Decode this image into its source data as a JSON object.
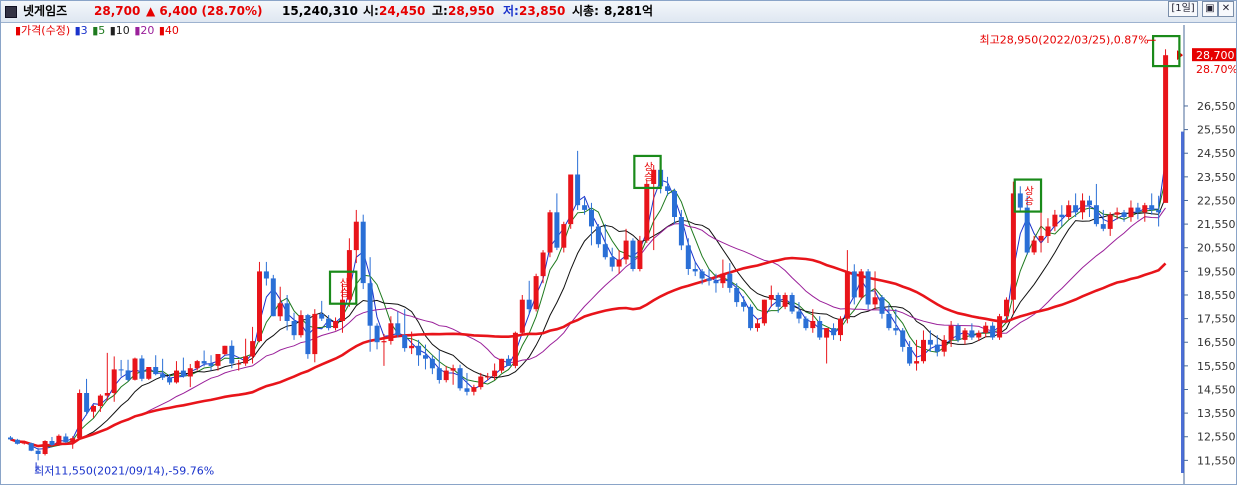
{
  "header": {
    "name": "넷게임즈",
    "price": "28,700",
    "change": "▲ 6,400 (28.70%)",
    "volume": "15,240,310",
    "open_label": "시:",
    "open": "24,450",
    "high_label": "고:",
    "high": "28,950",
    "low_label": "저:",
    "low": "23,850",
    "mktcap_label": "시총:",
    "mktcap": "8,281억",
    "period_button": "[1일]",
    "btn_restore": "▣",
    "btn_close": "✕",
    "btn_menu": "▪"
  },
  "legend": [
    {
      "text": "▮가격(수정)",
      "color": "#e60000"
    },
    {
      "text": "▮3",
      "color": "#1a33cc"
    },
    {
      "text": "▮5",
      "color": "#1e7a1e"
    },
    {
      "text": "▮10",
      "color": "#222222"
    },
    {
      "text": "▮20",
      "color": "#9a209a"
    },
    {
      "text": "▮40",
      "color": "#e60000"
    }
  ],
  "colors": {
    "up": "#e8141a",
    "down": "#2a6fd6",
    "ma3": "#1a33cc",
    "ma5": "#1e7a1e",
    "ma10": "#111111",
    "ma20": "#9a209a",
    "ma40": "#e8141a",
    "highlight": "#1a8a1a"
  },
  "annotations": {
    "high": "최고28,950(2022/03/25),0.87%",
    "low": "최저11,550(2021/09/14),-59.76%",
    "signal": "상승"
  },
  "chart_data": {
    "type": "candlestick",
    "ylim": [
      11100,
      29300
    ],
    "y_ticks": [
      11550,
      12550,
      13550,
      14550,
      15550,
      16550,
      17550,
      18550,
      19550,
      20550,
      21550,
      22550,
      23550,
      24550,
      25550,
      26550
    ],
    "current_price_label": "28,700",
    "current_change_label": "28.70%",
    "series": [
      {
        "name": "가격(수정)",
        "ohlc": [
          [
            12520,
            12580,
            12410,
            12440
          ],
          [
            12420,
            12460,
            12220,
            12250
          ],
          [
            12300,
            12380,
            12220,
            12300
          ],
          [
            12280,
            12300,
            11940,
            11960
          ],
          [
            11960,
            12070,
            11550,
            11820
          ],
          [
            11820,
            12400,
            11760,
            12370
          ],
          [
            12370,
            12540,
            12160,
            12200
          ],
          [
            12200,
            12650,
            12160,
            12590
          ],
          [
            12560,
            12690,
            12290,
            12320
          ],
          [
            12320,
            12570,
            12040,
            12490
          ],
          [
            12490,
            14550,
            12430,
            14400
          ],
          [
            14400,
            15000,
            13450,
            13600
          ],
          [
            13610,
            13900,
            13350,
            13850
          ],
          [
            13850,
            14350,
            13600,
            14290
          ],
          [
            14290,
            16100,
            14070,
            14400
          ],
          [
            14400,
            15950,
            14030,
            15400
          ],
          [
            15400,
            15800,
            15100,
            15360
          ],
          [
            15360,
            15810,
            14900,
            14960
          ],
          [
            14960,
            15900,
            14930,
            15860
          ],
          [
            15860,
            16000,
            14900,
            15000
          ],
          [
            15000,
            15500,
            14950,
            15500
          ],
          [
            15500,
            16000,
            15150,
            15200
          ],
          [
            15200,
            15850,
            14950,
            15050
          ],
          [
            15050,
            15200,
            14750,
            14850
          ],
          [
            14850,
            15750,
            14800,
            15350
          ],
          [
            15350,
            15900,
            15050,
            15100
          ],
          [
            15100,
            15630,
            14650,
            15450
          ],
          [
            15450,
            15800,
            15350,
            15750
          ],
          [
            15750,
            16200,
            15530,
            15650
          ],
          [
            15650,
            16000,
            15350,
            15550
          ],
          [
            15550,
            16050,
            15350,
            16050
          ],
          [
            16050,
            16400,
            16000,
            16400
          ],
          [
            16400,
            16630,
            15450,
            15650
          ],
          [
            15650,
            15800,
            15350,
            15650
          ],
          [
            15650,
            16700,
            15550,
            15950
          ],
          [
            15950,
            17200,
            15650,
            16600
          ],
          [
            16600,
            19950,
            16550,
            19550
          ],
          [
            19550,
            19950,
            18950,
            19250
          ],
          [
            19250,
            19400,
            17650,
            17650
          ],
          [
            17650,
            18900,
            17450,
            18200
          ],
          [
            18200,
            18550,
            17050,
            17450
          ],
          [
            17450,
            17800,
            16650,
            16850
          ],
          [
            16850,
            17900,
            16750,
            17700
          ],
          [
            17700,
            17750,
            15850,
            16050
          ],
          [
            16050,
            17950,
            15700,
            17750
          ],
          [
            17750,
            18300,
            17450,
            17550
          ],
          [
            17550,
            17700,
            17050,
            17150
          ],
          [
            17150,
            17600,
            17050,
            17450
          ],
          [
            17450,
            19050,
            16950,
            18350
          ],
          [
            18350,
            20950,
            18050,
            20450
          ],
          [
            20450,
            22150,
            19900,
            21650
          ],
          [
            21650,
            21950,
            18800,
            19050
          ],
          [
            19050,
            20150,
            16150,
            17250
          ],
          [
            17250,
            17350,
            16250,
            16550
          ],
          [
            16550,
            16900,
            15550,
            16600
          ],
          [
            16600,
            17650,
            16450,
            17350
          ],
          [
            17350,
            17850,
            16750,
            16850
          ],
          [
            16850,
            17950,
            16150,
            16300
          ],
          [
            16300,
            17000,
            16050,
            16400
          ],
          [
            16400,
            16650,
            15550,
            16000
          ],
          [
            16000,
            16450,
            15400,
            15850
          ],
          [
            15850,
            16000,
            15200,
            15450
          ],
          [
            15450,
            16200,
            14800,
            14950
          ],
          [
            14950,
            15550,
            14850,
            15350
          ],
          [
            15350,
            15600,
            14750,
            15450
          ],
          [
            15450,
            15600,
            14500,
            14600
          ],
          [
            14600,
            15250,
            14300,
            14450
          ],
          [
            14450,
            14750,
            14300,
            14650
          ],
          [
            14650,
            15250,
            14550,
            15100
          ],
          [
            15100,
            15250,
            14950,
            15100
          ],
          [
            15100,
            15650,
            14950,
            15350
          ],
          [
            15350,
            15850,
            15250,
            15850
          ],
          [
            15850,
            16000,
            15550,
            15550
          ],
          [
            15550,
            17000,
            15450,
            16950
          ],
          [
            16950,
            18550,
            16850,
            18350
          ],
          [
            18350,
            19150,
            17750,
            17950
          ],
          [
            17950,
            19450,
            17850,
            19350
          ],
          [
            19350,
            20450,
            19050,
            20350
          ],
          [
            20350,
            22150,
            20150,
            22050
          ],
          [
            22050,
            22850,
            20450,
            20550
          ],
          [
            20550,
            21650,
            20350,
            21550
          ],
          [
            21550,
            23650,
            21350,
            23650
          ],
          [
            23650,
            24650,
            22150,
            22350
          ],
          [
            22350,
            22650,
            21950,
            22150
          ],
          [
            22150,
            22450,
            20650,
            21450
          ],
          [
            21450,
            21550,
            20550,
            20700
          ],
          [
            20700,
            21550,
            20050,
            20150
          ],
          [
            20150,
            20550,
            19550,
            19750
          ],
          [
            19750,
            20450,
            19450,
            20050
          ],
          [
            20050,
            21350,
            19850,
            20850
          ],
          [
            20850,
            20950,
            19550,
            19650
          ],
          [
            19650,
            21050,
            19550,
            20850
          ],
          [
            20850,
            23400,
            20750,
            23250
          ],
          [
            23250,
            24050,
            20450,
            23850
          ],
          [
            23850,
            24050,
            22850,
            23150
          ],
          [
            23150,
            23550,
            22750,
            22950
          ],
          [
            22950,
            23050,
            21550,
            21850
          ],
          [
            21850,
            22150,
            20450,
            20650
          ],
          [
            20650,
            20950,
            19400,
            19650
          ],
          [
            19650,
            19950,
            19350,
            19550
          ],
          [
            19550,
            19650,
            19000,
            19250
          ],
          [
            19250,
            19650,
            18950,
            19150
          ],
          [
            19150,
            19450,
            18650,
            19050
          ],
          [
            19050,
            20050,
            18850,
            19450
          ],
          [
            19450,
            19900,
            18650,
            18850
          ],
          [
            18850,
            19050,
            18050,
            18250
          ],
          [
            18250,
            18500,
            17850,
            18050
          ],
          [
            18050,
            18150,
            17050,
            17150
          ],
          [
            17150,
            17550,
            17000,
            17350
          ],
          [
            17350,
            18350,
            17250,
            18350
          ],
          [
            18350,
            18950,
            18050,
            18550
          ],
          [
            18550,
            18650,
            17800,
            18050
          ],
          [
            18050,
            18650,
            17950,
            18550
          ],
          [
            18550,
            18650,
            17750,
            17850
          ],
          [
            17850,
            18250,
            17350,
            17550
          ],
          [
            17550,
            17650,
            17050,
            17150
          ],
          [
            17150,
            17950,
            16950,
            17450
          ],
          [
            17450,
            17650,
            16650,
            16750
          ],
          [
            16750,
            17150,
            15650,
            17150
          ],
          [
            17150,
            17350,
            16650,
            16850
          ],
          [
            16850,
            17650,
            16600,
            17550
          ],
          [
            17550,
            20450,
            17350,
            19550
          ],
          [
            19550,
            19850,
            18150,
            18450
          ],
          [
            18450,
            19650,
            18350,
            19550
          ],
          [
            19550,
            19650,
            17950,
            18150
          ],
          [
            18150,
            19550,
            17950,
            18450
          ],
          [
            18450,
            18550,
            17550,
            17750
          ],
          [
            17750,
            18150,
            17050,
            17150
          ],
          [
            17150,
            17950,
            16850,
            17050
          ],
          [
            17050,
            17150,
            16150,
            16350
          ],
          [
            16350,
            16600,
            15550,
            15650
          ],
          [
            15650,
            16650,
            15350,
            15750
          ],
          [
            15750,
            17050,
            15650,
            16650
          ],
          [
            16650,
            17050,
            16150,
            16450
          ],
          [
            16450,
            16850,
            15950,
            16150
          ],
          [
            16150,
            16850,
            15950,
            16650
          ],
          [
            16650,
            17450,
            16350,
            17250
          ],
          [
            17250,
            17350,
            16550,
            16650
          ],
          [
            16650,
            17150,
            16450,
            17050
          ],
          [
            17050,
            17350,
            16650,
            16750
          ],
          [
            16750,
            17050,
            16600,
            16950
          ],
          [
            16950,
            17400,
            16750,
            17250
          ],
          [
            17250,
            17400,
            16650,
            16750
          ],
          [
            16750,
            17750,
            16650,
            17650
          ],
          [
            17650,
            18450,
            17450,
            18350
          ],
          [
            18350,
            23350,
            17750,
            22850
          ],
          [
            22850,
            23150,
            22050,
            22250
          ],
          [
            22250,
            22750,
            20250,
            20350
          ],
          [
            20350,
            21050,
            20250,
            20850
          ],
          [
            20850,
            22850,
            20350,
            21050
          ],
          [
            21050,
            21800,
            20750,
            21450
          ],
          [
            21450,
            22150,
            21250,
            21950
          ],
          [
            21950,
            22350,
            21450,
            21850
          ],
          [
            21850,
            22550,
            21750,
            22350
          ],
          [
            22350,
            22850,
            21850,
            22050
          ],
          [
            22050,
            22850,
            21750,
            22550
          ],
          [
            22550,
            22750,
            21850,
            22350
          ],
          [
            22350,
            23250,
            21450,
            21550
          ],
          [
            21550,
            22150,
            21250,
            21350
          ],
          [
            21350,
            22050,
            21050,
            21950
          ],
          [
            21950,
            22250,
            21750,
            22050
          ],
          [
            22050,
            22150,
            21650,
            21850
          ],
          [
            21850,
            22550,
            21650,
            22250
          ],
          [
            22250,
            22450,
            21750,
            22050
          ],
          [
            22050,
            22450,
            21650,
            22350
          ],
          [
            22350,
            22850,
            21950,
            22150
          ],
          [
            22150,
            22750,
            21450,
            22050
          ],
          [
            22450,
            28950,
            24350,
            28700
          ]
        ]
      },
      {
        "name": "3",
        "window": 3
      },
      {
        "name": "5",
        "window": 5
      },
      {
        "name": "10",
        "window": 10
      },
      {
        "name": "20",
        "window": 20
      },
      {
        "name": "40",
        "window": 40
      }
    ],
    "high_marker": {
      "index": 165,
      "price": 28950
    },
    "low_marker": {
      "index": 4,
      "price": 11550
    },
    "signal_markers": [
      {
        "index": 48
      },
      {
        "index": 92
      },
      {
        "index": 147
      }
    ]
  }
}
